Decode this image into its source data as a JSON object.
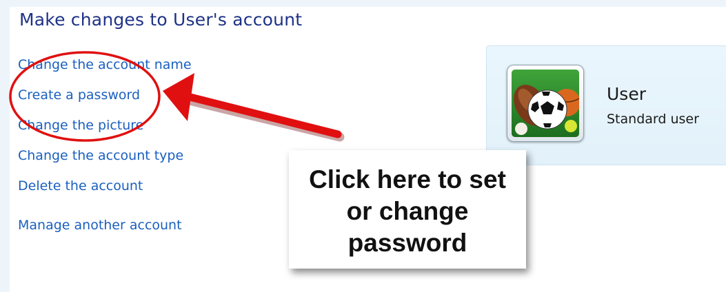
{
  "page": {
    "title": "Make changes to User's account"
  },
  "tasks": {
    "change_name": "Change the account name",
    "create_password": "Create a password",
    "change_picture": "Change the picture",
    "change_type": "Change the account type",
    "delete_account": "Delete the account",
    "manage_another": "Manage another account"
  },
  "account": {
    "name": "User",
    "type": "Standard user",
    "picture_icon": "sports-balls-picture"
  },
  "callout": {
    "line1": "Click here to set",
    "line2": "or change",
    "line3": "password"
  },
  "colors": {
    "link": "#1a5fbf",
    "title": "#1e3287",
    "annotation": "#e01010"
  }
}
